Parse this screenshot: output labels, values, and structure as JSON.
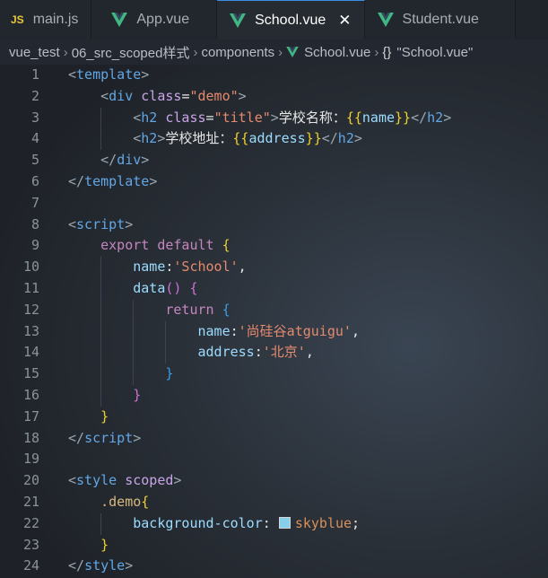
{
  "tabs": [
    {
      "label": "main.js",
      "icon": "js-icon",
      "active": false
    },
    {
      "label": "App.vue",
      "icon": "vue-icon",
      "active": false
    },
    {
      "label": "School.vue",
      "icon": "vue-icon",
      "active": true
    },
    {
      "label": "Student.vue",
      "icon": "vue-icon",
      "active": false
    }
  ],
  "tab_js_badge": "JS",
  "breadcrumb": {
    "items": [
      "vue_test",
      "06_src_scoped样式",
      "components",
      "School.vue",
      "\"School.vue\""
    ],
    "braces": "{}"
  },
  "colors": {
    "vue_green": "#41b883",
    "swatch": "#87ceeb",
    "active_border": "#3a8ee6"
  },
  "line_numbers": [
    "1",
    "2",
    "3",
    "4",
    "5",
    "6",
    "7",
    "8",
    "9",
    "10",
    "11",
    "12",
    "13",
    "14",
    "15",
    "16",
    "17",
    "18",
    "19",
    "20",
    "21",
    "22",
    "23",
    "24"
  ],
  "code": {
    "l1": [
      "<",
      "template",
      ">"
    ],
    "l2": [
      "<",
      "div",
      " ",
      "class",
      "=",
      "\"demo\"",
      ">"
    ],
    "l3": [
      "<",
      "h2",
      " ",
      "class",
      "=",
      "\"title\"",
      ">",
      "学校名称：",
      "{{",
      "name",
      "}}",
      "</",
      "h2",
      ">"
    ],
    "l4": [
      "<",
      "h2",
      ">",
      "学校地址：",
      "{{",
      "address",
      "}}",
      "</",
      "h2",
      ">"
    ],
    "l5": [
      "</",
      "div",
      ">"
    ],
    "l6": [
      "</",
      "template",
      ">"
    ],
    "l8": [
      "<",
      "script",
      ">"
    ],
    "l9": [
      "export",
      " ",
      "default",
      " ",
      "{"
    ],
    "l10": [
      "name",
      ":",
      "'School'",
      ","
    ],
    "l11": [
      "data",
      "()",
      " ",
      "{"
    ],
    "l12": [
      "return",
      " ",
      "{"
    ],
    "l13": [
      "name",
      ":",
      "'尚硅谷atguigu'",
      ","
    ],
    "l14": [
      "address",
      ":",
      "'北京'",
      ","
    ],
    "l15": [
      "}"
    ],
    "l16": [
      "}"
    ],
    "l17": [
      "}"
    ],
    "l18": [
      "</",
      "script",
      ">"
    ],
    "l20": [
      "<",
      "style",
      " ",
      "scoped",
      ">"
    ],
    "l21": [
      ".demo",
      "{"
    ],
    "l22": [
      "background-color",
      ":",
      " ",
      "skyblue",
      ";"
    ],
    "l23": [
      "}"
    ],
    "l24": [
      "</",
      "style",
      ">"
    ]
  }
}
